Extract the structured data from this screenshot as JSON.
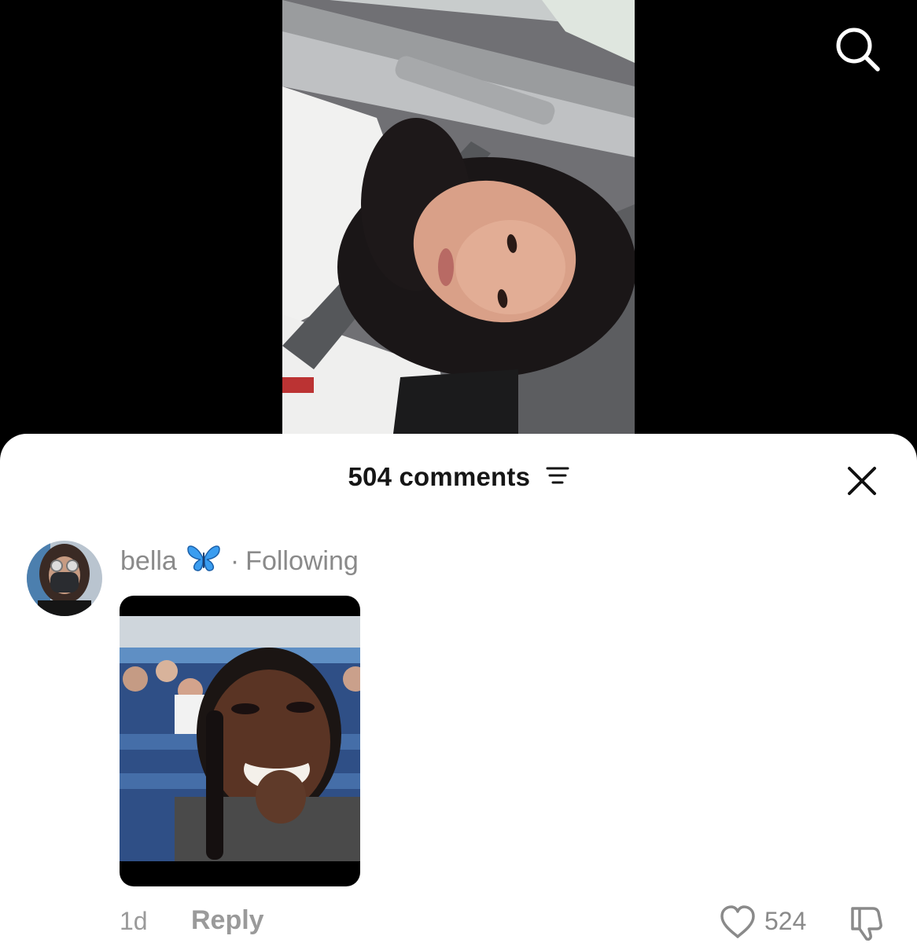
{
  "top": {
    "search_icon": "search-icon"
  },
  "comments_sheet": {
    "title": "504 comments",
    "sort_icon": "sort-lines-icon",
    "close_icon": "close-icon",
    "comment": {
      "username": "bella",
      "username_emoji": "butterfly-icon",
      "separator": "·",
      "relation": "Following",
      "media": "reaction-photo",
      "time": "1d",
      "reply_label": "Reply",
      "like_count": "524",
      "like_icon": "heart-icon",
      "dislike_icon": "thumbs-down-icon"
    }
  },
  "colors": {
    "sheet_background": "#ffffff",
    "page_background": "#000000",
    "muted_text": "#8a8a8a",
    "butterfly_blue": "#3a9df0"
  }
}
